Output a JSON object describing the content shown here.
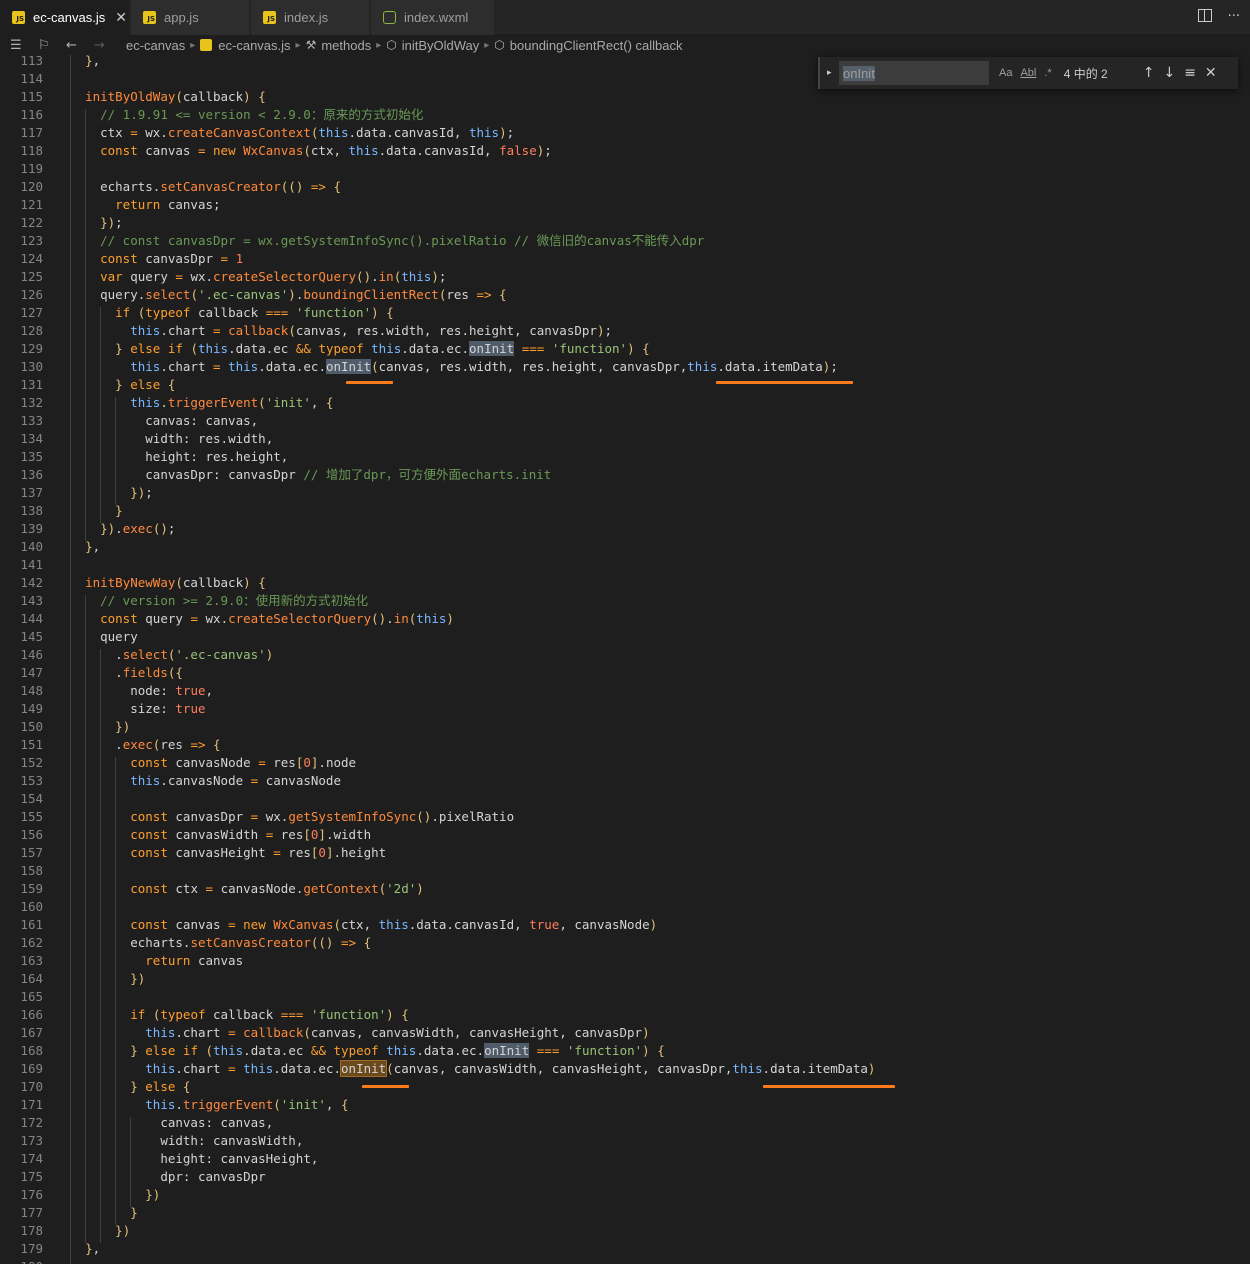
{
  "tabs": [
    {
      "label": "ec-canvas.js",
      "icon": "js-file-icon",
      "active": true
    },
    {
      "label": "app.js",
      "icon": "js-file-icon",
      "active": false
    },
    {
      "label": "index.js",
      "icon": "js-file-icon",
      "active": false
    },
    {
      "label": "index.wxml",
      "icon": "wxml-file-icon",
      "active": false
    }
  ],
  "breadcrumb": {
    "folder": "ec-canvas",
    "file": "ec-canvas.js",
    "methods": "methods",
    "method": "initByOldWay",
    "callback": "boundingClientRect() callback"
  },
  "find": {
    "query": "onInit",
    "match_case": "Aa",
    "whole_word": "Abl",
    "regex": ".*",
    "result": "4 中的 2"
  },
  "code": {
    "first_line": 113,
    "lines": [
      "  },",
      "",
      "  initByOldWay(callback) {",
      "    // 1.9.91 <= version < 2.9.0：原来的方式初始化",
      "    ctx = wx.createCanvasContext(this.data.canvasId, this);",
      "    const canvas = new WxCanvas(ctx, this.data.canvasId, false);",
      "",
      "    echarts.setCanvasCreator(() => {",
      "      return canvas;",
      "    });",
      "    // const canvasDpr = wx.getSystemInfoSync().pixelRatio // 微信旧的canvas不能传入dpr",
      "    const canvasDpr = 1",
      "    var query = wx.createSelectorQuery().in(this);",
      "    query.select('.ec-canvas').boundingClientRect(res => {",
      "      if (typeof callback === 'function') {",
      "        this.chart = callback(canvas, res.width, res.height, canvasDpr);",
      "      } else if (this.data.ec && typeof this.data.ec.onInit === 'function') {",
      "        this.chart = this.data.ec.onInit(canvas, res.width, res.height, canvasDpr,this.data.itemData);",
      "      } else {",
      "        this.triggerEvent('init', {",
      "          canvas: canvas,",
      "          width: res.width,",
      "          height: res.height,",
      "          canvasDpr: canvasDpr // 增加了dpr，可方便外面echarts.init",
      "        });",
      "      }",
      "    }).exec();",
      "  },",
      "",
      "  initByNewWay(callback) {",
      "    // version >= 2.9.0：使用新的方式初始化",
      "    const query = wx.createSelectorQuery().in(this)",
      "    query",
      "      .select('.ec-canvas')",
      "      .fields({",
      "        node: true,",
      "        size: true",
      "      })",
      "      .exec(res => {",
      "        const canvasNode = res[0].node",
      "        this.canvasNode = canvasNode",
      "",
      "        const canvasDpr = wx.getSystemInfoSync().pixelRatio",
      "        const canvasWidth = res[0].width",
      "        const canvasHeight = res[0].height",
      "",
      "        const ctx = canvasNode.getContext('2d')",
      "",
      "        const canvas = new WxCanvas(ctx, this.data.canvasId, true, canvasNode)",
      "        echarts.setCanvasCreator(() => {",
      "          return canvas",
      "        })",
      "",
      "        if (typeof callback === 'function') {",
      "          this.chart = callback(canvas, canvasWidth, canvasHeight, canvasDpr)",
      "        } else if (this.data.ec && typeof this.data.ec.onInit === 'function') {",
      "          this.chart = this.data.ec.onInit(canvas, canvasWidth, canvasHeight, canvasDpr,this.data.itemData)",
      "        } else {",
      "          this.triggerEvent('init', {",
      "            canvas: canvas,",
      "            width: canvasWidth,",
      "            height: canvasHeight,",
      "            dpr: canvasDpr",
      "          })",
      "        }",
      "      })",
      "  },",
      "  "
    ]
  },
  "colors": {
    "background": "#1e1e1e",
    "underline": "#ff7b1a",
    "keyword": "#ff9f2e",
    "string": "#98c379",
    "comment": "#6a9955"
  }
}
